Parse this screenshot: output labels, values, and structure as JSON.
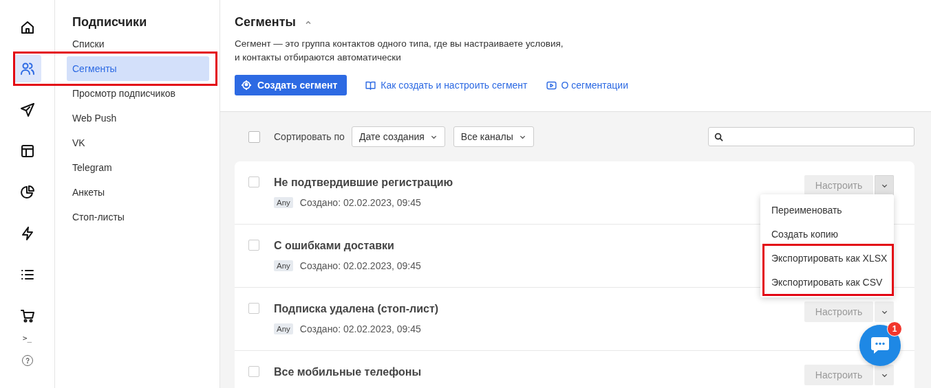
{
  "rail": {
    "items": [
      {
        "selected": false
      },
      {
        "selected": true
      },
      {
        "selected": false
      },
      {
        "selected": false
      },
      {
        "selected": false
      },
      {
        "selected": false
      },
      {
        "selected": false
      },
      {
        "selected": false
      }
    ],
    "terminal": ">_"
  },
  "subnav": {
    "title": "Подписчики",
    "items": [
      {
        "label": "Списки",
        "selected": false,
        "highlighted": false
      },
      {
        "label": "Сегменты",
        "selected": true,
        "highlighted": true
      },
      {
        "label": "Просмотр подписчиков",
        "selected": false,
        "highlighted": false
      },
      {
        "label": "Web Push",
        "selected": false,
        "highlighted": false
      },
      {
        "label": "VK",
        "selected": false,
        "highlighted": false
      },
      {
        "label": "Telegram",
        "selected": false,
        "highlighted": false
      },
      {
        "label": "Анкеты",
        "selected": false,
        "highlighted": false
      },
      {
        "label": "Стоп-листы",
        "selected": false,
        "highlighted": false
      }
    ]
  },
  "header": {
    "title": "Сегменты",
    "expanded": true,
    "description_lines": [
      "Сегмент — это группа контактов одного типа, где вы настраиваете условия,",
      "и контакты отбираются автоматически"
    ],
    "primary_button": "Создать сегмент",
    "links": [
      {
        "label": "Как создать и настроить сегмент"
      },
      {
        "label": "О сегментации"
      }
    ]
  },
  "toolbar": {
    "select_all_checked": false,
    "sort_label": "Сортировать по",
    "dropdowns": [
      "Дате создания",
      "Все каналы"
    ]
  },
  "segments": [
    {
      "name": "Не подтвердившие регистрацию",
      "tag": "Any",
      "created": "Создано: 02.02.2023, 09:45",
      "checked": false,
      "action": "Настроить",
      "menu_open": true
    },
    {
      "name": "С ошибками доставки",
      "tag": "Any",
      "created": "Создано: 02.02.2023, 09:45",
      "checked": false
    },
    {
      "name": "Подписка удалена (стоп-лист)",
      "tag": "Any",
      "created": "Создано: 02.02.2023, 09:45",
      "checked": false,
      "action": "Настроить",
      "menu_open": false
    },
    {
      "name": "Все мобильные телефоны",
      "checked": false,
      "action": "Настроить",
      "menu_open": false
    }
  ],
  "menu": {
    "items": [
      {
        "label": "Переименовать",
        "highlighted": false
      },
      {
        "label": "Создать копию",
        "highlighted": false
      },
      {
        "label": "Экспортировать как XLSX",
        "highlighted": true
      },
      {
        "label": "Экспортировать как CSV",
        "highlighted": true
      }
    ]
  },
  "chat": {
    "badge": "1"
  }
}
